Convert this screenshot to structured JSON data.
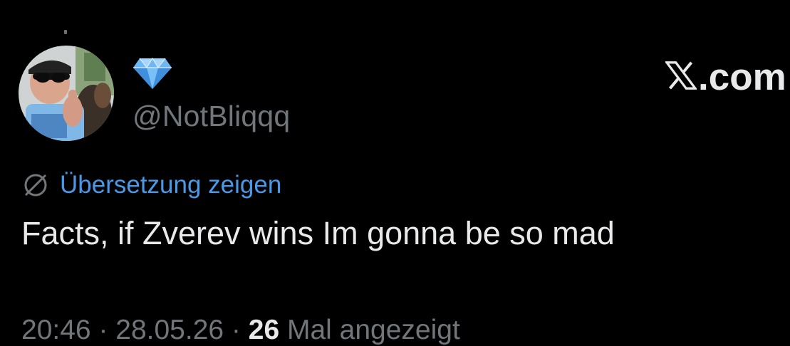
{
  "author": {
    "handle": "@NotBliqqq",
    "badge_icon": "diamond-icon",
    "avatar_icon": "profile-photo"
  },
  "brand": {
    "label": ".com",
    "logo_icon": "x-logo-icon"
  },
  "translate": {
    "label": "Übersetzung zeigen",
    "icon": "globe-slash-icon"
  },
  "tweet": {
    "text": "Facts, if Zverev wins Im gonna be so mad"
  },
  "meta": {
    "time": "20:46",
    "sep1": " · ",
    "date": "28.05.26",
    "sep2": " · ",
    "views_count": "26",
    "views_label": " Mal angezeigt"
  },
  "colors": {
    "background": "#000000",
    "text": "#e7e9ea",
    "secondary": "#71767b",
    "link": "#4a99e9",
    "badge": "#6fb6f2"
  }
}
